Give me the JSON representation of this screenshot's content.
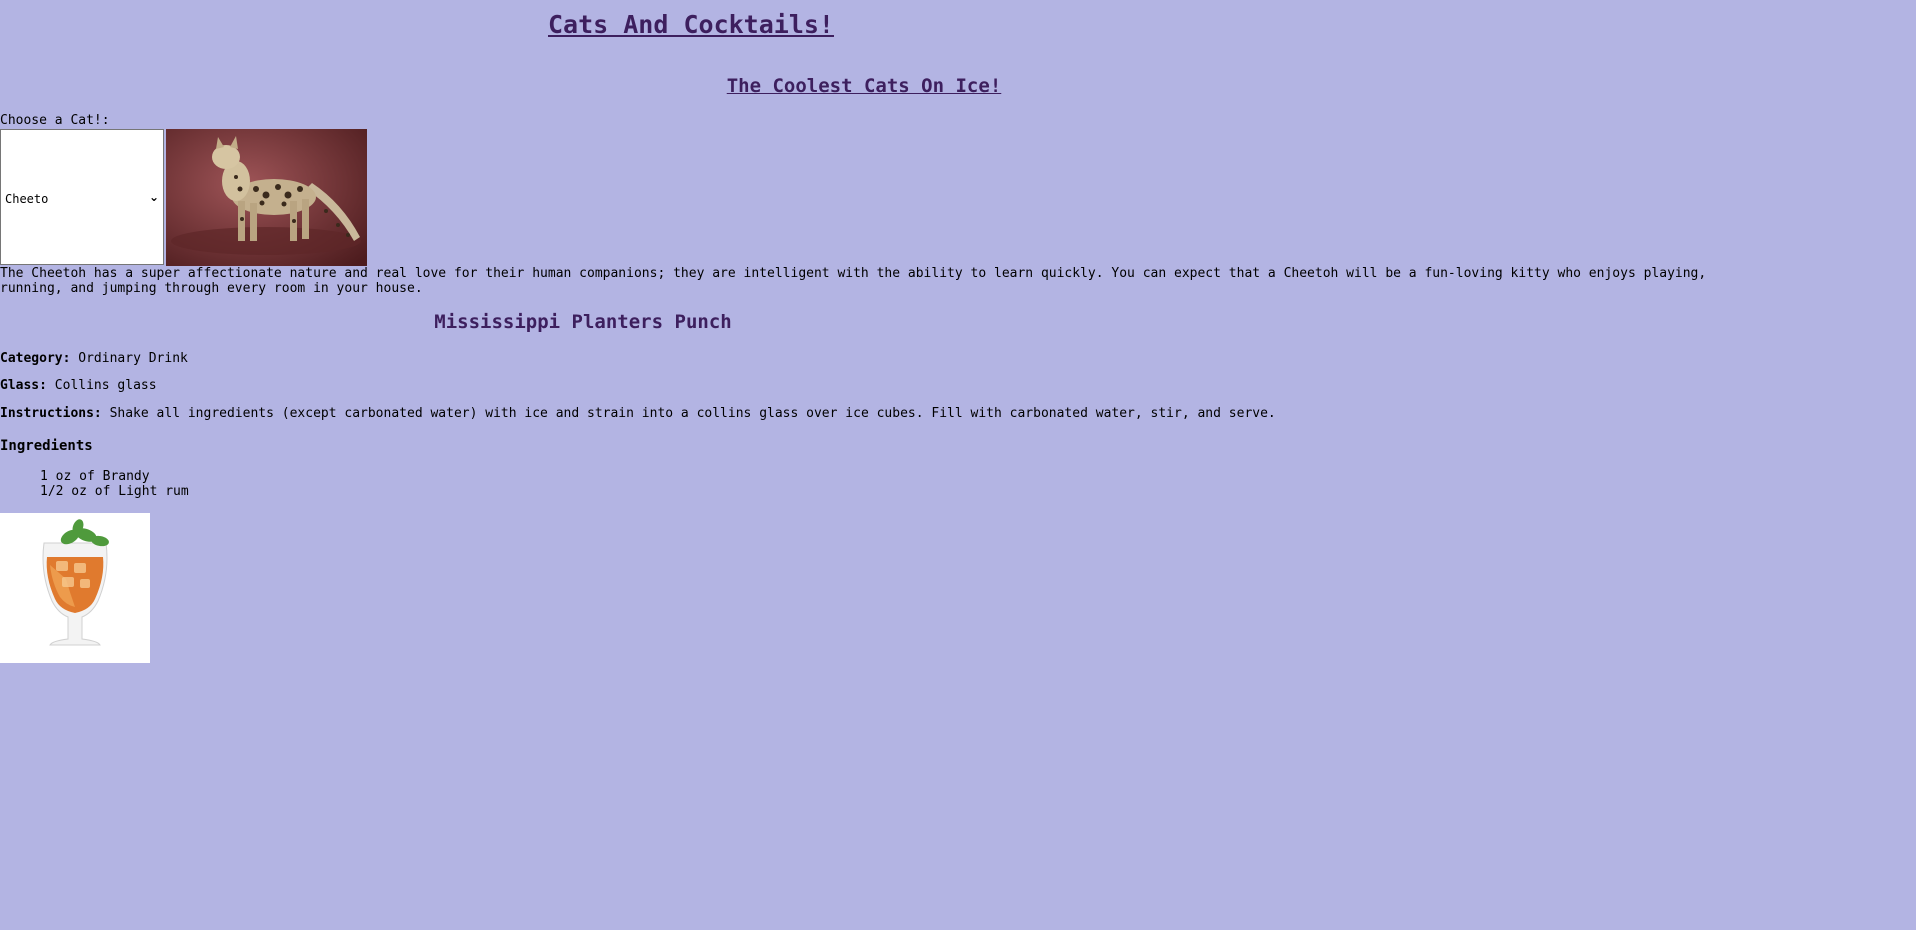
{
  "header": {
    "title": "Cats And Cocktails!",
    "subtitle": "The Coolest Cats On Ice!"
  },
  "cat": {
    "choose_label": "Choose a Cat!:",
    "selected": "Cheeto",
    "description": "The Cheetoh has a super affectionate nature and real love for their human companions; they are intelligent with the ability to learn quickly. You can expect that a Cheetoh will be a fun-loving kitty who enjoys playing, running, and jumping through every room in your house."
  },
  "drink": {
    "name": "Mississippi Planters Punch",
    "category_label": "Category:",
    "category": "Ordinary Drink",
    "glass_label": "Glass:",
    "glass": "Collins glass",
    "instructions_label": "Instructions:",
    "instructions": "Shake all ingredients (except carbonated water) with ice and strain into a collins glass over ice cubes. Fill with carbonated water, stir, and serve.",
    "ingredients_heading": "Ingredients",
    "ingredients": [
      "1 oz of Brandy",
      "1/2 oz of Light rum"
    ]
  },
  "icons": {
    "select_arrow": "chevron-down-icon"
  },
  "colors": {
    "background": "#b3b4e3",
    "heading": "#3d1f5e"
  }
}
